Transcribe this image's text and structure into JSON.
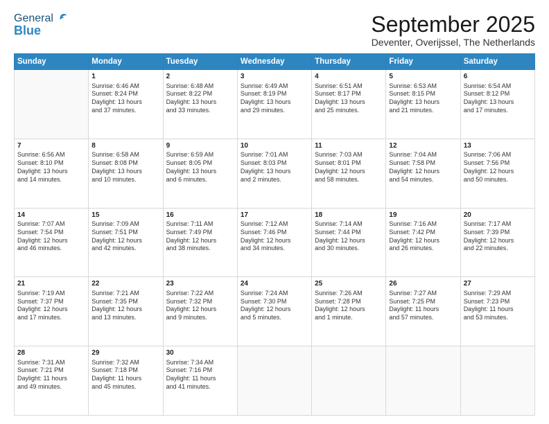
{
  "header": {
    "logo_general": "General",
    "logo_blue": "Blue",
    "month_title": "September 2025",
    "location": "Deventer, Overijssel, The Netherlands"
  },
  "days_of_week": [
    "Sunday",
    "Monday",
    "Tuesday",
    "Wednesday",
    "Thursday",
    "Friday",
    "Saturday"
  ],
  "weeks": [
    [
      {
        "day": "",
        "info": ""
      },
      {
        "day": "1",
        "info": "Sunrise: 6:46 AM\nSunset: 8:24 PM\nDaylight: 13 hours\nand 37 minutes."
      },
      {
        "day": "2",
        "info": "Sunrise: 6:48 AM\nSunset: 8:22 PM\nDaylight: 13 hours\nand 33 minutes."
      },
      {
        "day": "3",
        "info": "Sunrise: 6:49 AM\nSunset: 8:19 PM\nDaylight: 13 hours\nand 29 minutes."
      },
      {
        "day": "4",
        "info": "Sunrise: 6:51 AM\nSunset: 8:17 PM\nDaylight: 13 hours\nand 25 minutes."
      },
      {
        "day": "5",
        "info": "Sunrise: 6:53 AM\nSunset: 8:15 PM\nDaylight: 13 hours\nand 21 minutes."
      },
      {
        "day": "6",
        "info": "Sunrise: 6:54 AM\nSunset: 8:12 PM\nDaylight: 13 hours\nand 17 minutes."
      }
    ],
    [
      {
        "day": "7",
        "info": "Sunrise: 6:56 AM\nSunset: 8:10 PM\nDaylight: 13 hours\nand 14 minutes."
      },
      {
        "day": "8",
        "info": "Sunrise: 6:58 AM\nSunset: 8:08 PM\nDaylight: 13 hours\nand 10 minutes."
      },
      {
        "day": "9",
        "info": "Sunrise: 6:59 AM\nSunset: 8:05 PM\nDaylight: 13 hours\nand 6 minutes."
      },
      {
        "day": "10",
        "info": "Sunrise: 7:01 AM\nSunset: 8:03 PM\nDaylight: 13 hours\nand 2 minutes."
      },
      {
        "day": "11",
        "info": "Sunrise: 7:03 AM\nSunset: 8:01 PM\nDaylight: 12 hours\nand 58 minutes."
      },
      {
        "day": "12",
        "info": "Sunrise: 7:04 AM\nSunset: 7:58 PM\nDaylight: 12 hours\nand 54 minutes."
      },
      {
        "day": "13",
        "info": "Sunrise: 7:06 AM\nSunset: 7:56 PM\nDaylight: 12 hours\nand 50 minutes."
      }
    ],
    [
      {
        "day": "14",
        "info": "Sunrise: 7:07 AM\nSunset: 7:54 PM\nDaylight: 12 hours\nand 46 minutes."
      },
      {
        "day": "15",
        "info": "Sunrise: 7:09 AM\nSunset: 7:51 PM\nDaylight: 12 hours\nand 42 minutes."
      },
      {
        "day": "16",
        "info": "Sunrise: 7:11 AM\nSunset: 7:49 PM\nDaylight: 12 hours\nand 38 minutes."
      },
      {
        "day": "17",
        "info": "Sunrise: 7:12 AM\nSunset: 7:46 PM\nDaylight: 12 hours\nand 34 minutes."
      },
      {
        "day": "18",
        "info": "Sunrise: 7:14 AM\nSunset: 7:44 PM\nDaylight: 12 hours\nand 30 minutes."
      },
      {
        "day": "19",
        "info": "Sunrise: 7:16 AM\nSunset: 7:42 PM\nDaylight: 12 hours\nand 26 minutes."
      },
      {
        "day": "20",
        "info": "Sunrise: 7:17 AM\nSunset: 7:39 PM\nDaylight: 12 hours\nand 22 minutes."
      }
    ],
    [
      {
        "day": "21",
        "info": "Sunrise: 7:19 AM\nSunset: 7:37 PM\nDaylight: 12 hours\nand 17 minutes."
      },
      {
        "day": "22",
        "info": "Sunrise: 7:21 AM\nSunset: 7:35 PM\nDaylight: 12 hours\nand 13 minutes."
      },
      {
        "day": "23",
        "info": "Sunrise: 7:22 AM\nSunset: 7:32 PM\nDaylight: 12 hours\nand 9 minutes."
      },
      {
        "day": "24",
        "info": "Sunrise: 7:24 AM\nSunset: 7:30 PM\nDaylight: 12 hours\nand 5 minutes."
      },
      {
        "day": "25",
        "info": "Sunrise: 7:26 AM\nSunset: 7:28 PM\nDaylight: 12 hours\nand 1 minute."
      },
      {
        "day": "26",
        "info": "Sunrise: 7:27 AM\nSunset: 7:25 PM\nDaylight: 11 hours\nand 57 minutes."
      },
      {
        "day": "27",
        "info": "Sunrise: 7:29 AM\nSunset: 7:23 PM\nDaylight: 11 hours\nand 53 minutes."
      }
    ],
    [
      {
        "day": "28",
        "info": "Sunrise: 7:31 AM\nSunset: 7:21 PM\nDaylight: 11 hours\nand 49 minutes."
      },
      {
        "day": "29",
        "info": "Sunrise: 7:32 AM\nSunset: 7:18 PM\nDaylight: 11 hours\nand 45 minutes."
      },
      {
        "day": "30",
        "info": "Sunrise: 7:34 AM\nSunset: 7:16 PM\nDaylight: 11 hours\nand 41 minutes."
      },
      {
        "day": "",
        "info": ""
      },
      {
        "day": "",
        "info": ""
      },
      {
        "day": "",
        "info": ""
      },
      {
        "day": "",
        "info": ""
      }
    ]
  ]
}
